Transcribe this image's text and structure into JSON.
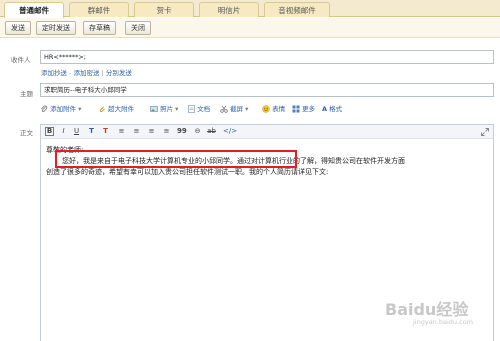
{
  "tabs": [
    "普通邮件",
    "群邮件",
    "贺卡",
    "明信片",
    "音视频邮件"
  ],
  "actions": [
    "发送",
    "定时发送",
    "存草稿",
    "关闭"
  ],
  "recipient": {
    "label": "收件人",
    "value": "HR<******>;"
  },
  "recipient_links": {
    "add_cc": "添加抄送",
    "add_bcc": "添加密送",
    "separate_send": "分别发送",
    "sep": "-",
    "sep2": "|"
  },
  "subject": {
    "label": "主题",
    "value": "求职简历--电子科大小邱同学"
  },
  "attach_toolbar": {
    "add_attachment": "添加附件",
    "large_attachment": "超大附件",
    "photo": "照片",
    "document": "文档",
    "screenshot": "截屏",
    "emoji": "表情",
    "more": "更多",
    "format": "格式"
  },
  "body_label": "正文",
  "editor_tools": [
    "B",
    "I",
    "U",
    "T",
    "T",
    "≡",
    "≡",
    "≡",
    "≡",
    "99",
    "⊖",
    "ab",
    "</>"
  ],
  "editor": {
    "greeting": "尊敬的老师:",
    "line1_highlight": "您好，我是来自于电子科技大学计算机专业的小邱同学。",
    "line1_rest": "通过对计算机行业的了解，得知贵公司在软件开发方面",
    "line2": "创造了很多的奇迹，希望有幸可以加入贵公司担任软件测试一职。我的个人简历请详见下文:"
  },
  "watermark": {
    "brand": "Baidu经验",
    "url": "jingyan.baidu.com"
  },
  "colors": {
    "highlight": "#e32020",
    "link": "#2b5fa7",
    "tab_bg": "#f4ead0"
  }
}
